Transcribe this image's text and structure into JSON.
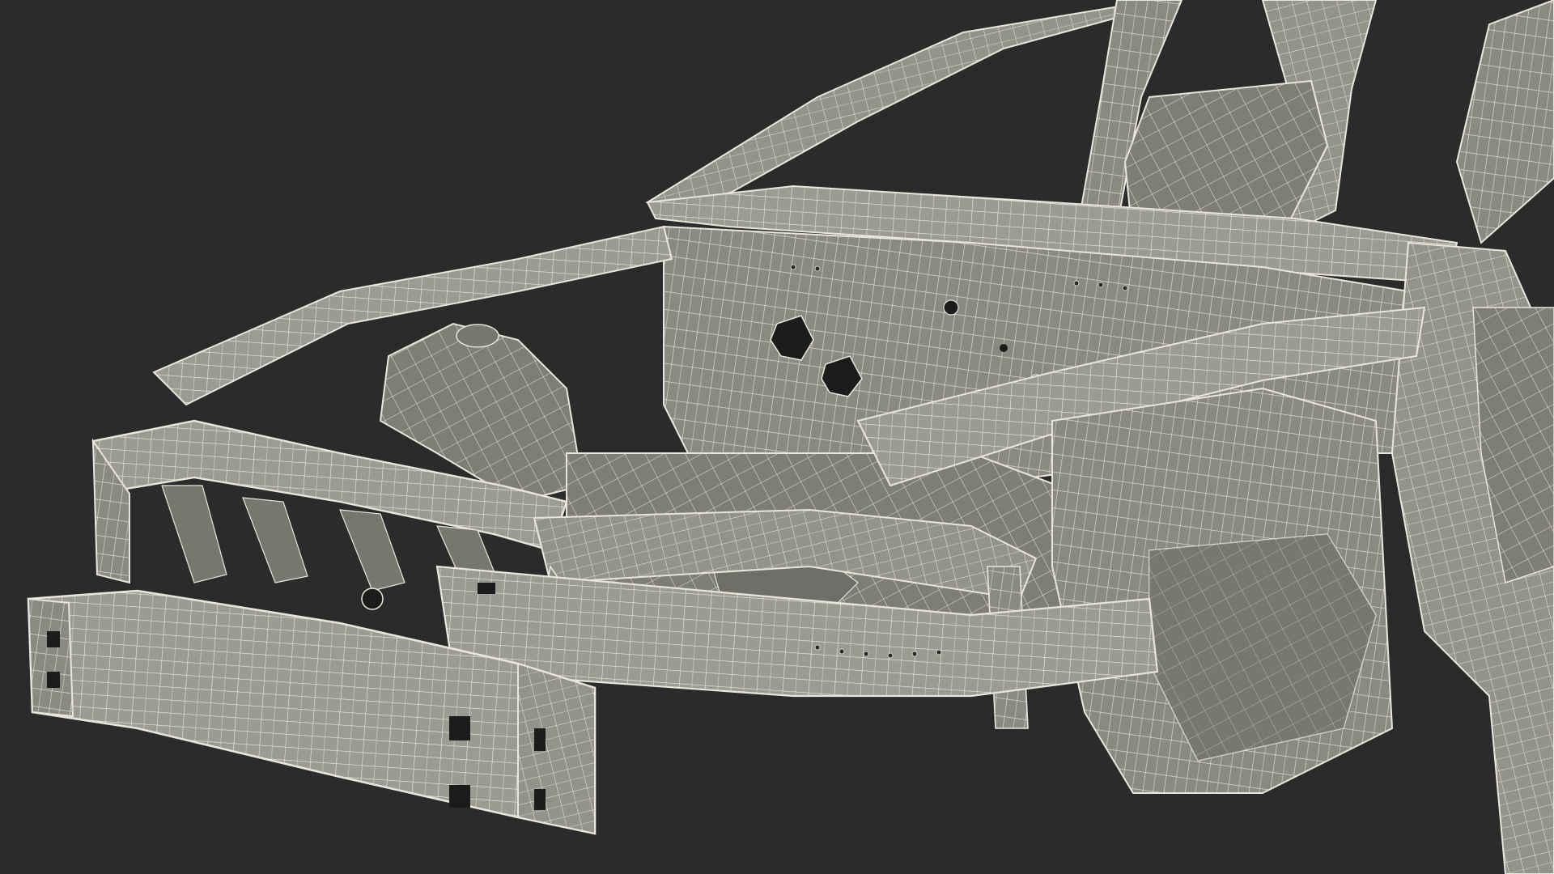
{
  "scene": {
    "subject": "car-body-in-white-wireframe",
    "colors": {
      "background": "#2b2b2b",
      "panel": "#8b8a82",
      "panel_light": "#a09f97",
      "panel_dark": "#6f6e68",
      "wire": "#e8e6da",
      "hole": "#1c1c1c"
    }
  }
}
